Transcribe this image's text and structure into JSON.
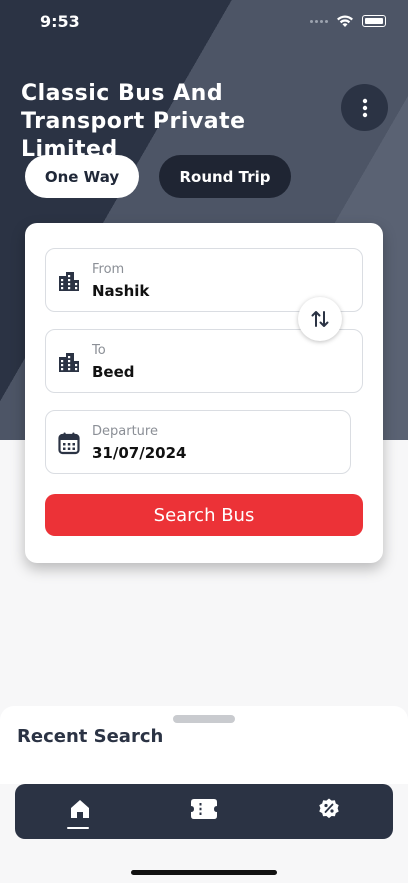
{
  "status_bar": {
    "time": "9:53"
  },
  "header": {
    "company_name": "Classic Bus And Transport Private Limited"
  },
  "trip_type": {
    "tabs": [
      {
        "label": "One Way",
        "selected": true
      },
      {
        "label": "Round Trip",
        "selected": false
      }
    ]
  },
  "search_form": {
    "from": {
      "label": "From",
      "value": "Nashik"
    },
    "to": {
      "label": "To",
      "value": "Beed"
    },
    "departure": {
      "label": "Departure",
      "value": "31/07/2024"
    },
    "search_button": "Search Bus"
  },
  "recent": {
    "title": "Recent Search"
  },
  "bottom_nav": {
    "items": [
      {
        "icon": "home-icon",
        "active": true
      },
      {
        "icon": "ticket-icon",
        "active": false
      },
      {
        "icon": "offer-icon",
        "active": false
      }
    ]
  },
  "colors": {
    "header_bg": "#2b3344",
    "accent_red": "#ec3237",
    "tab_dark": "#1f2533"
  }
}
